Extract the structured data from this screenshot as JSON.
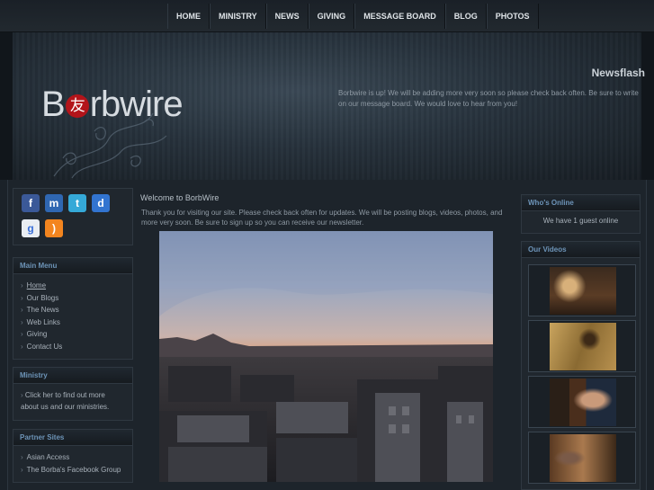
{
  "nav": {
    "items": [
      "HOME",
      "MINISTRY",
      "NEWS",
      "GIVING",
      "MESSAGE BOARD",
      "BLOG",
      "PHOTOS"
    ]
  },
  "header": {
    "logo_text_start": "B",
    "logo_kanji": "友",
    "logo_text_end": "rbwire",
    "newsflash_title": "Newsflash",
    "newsflash_text": "Borbwire is up!  We will be adding more very soon so please check back often.  Be sure to write on our message board.  We would love to hear from you!"
  },
  "social": {
    "icons": [
      "facebook-icon",
      "myspace-icon",
      "twitter-icon",
      "delicious-icon",
      "google-icon",
      "rss-icon"
    ],
    "colors": {
      "facebook": "#3b5998",
      "myspace": "#2f67b2",
      "twitter": "#35a9d8",
      "delicious": "#3274d0",
      "google": "#e9edf2",
      "rss": "#f3851f"
    }
  },
  "main_menu": {
    "title": "Main Menu",
    "items": [
      "Home",
      "Our Blogs",
      "The News",
      "Web Links",
      "Giving",
      "Contact Us"
    ]
  },
  "ministry": {
    "title": "Ministry",
    "text": "Click her to find out more about us and our ministries."
  },
  "partner_sites": {
    "title": "Partner Sites",
    "items": [
      "Asian Access",
      "The Borba's Facebook Group"
    ]
  },
  "content": {
    "welcome_title": "Welcome to BorbWire",
    "welcome_text": "Thank you for visiting our site.  Please check back often for updates.  We will be posting blogs, videos, photos, and more very soon.  Be sure to sign up so you can receive our newsletter."
  },
  "whos_online": {
    "title": "Who's Online",
    "text": "We have 1 guest online"
  },
  "our_videos": {
    "title": "Our Videos"
  }
}
